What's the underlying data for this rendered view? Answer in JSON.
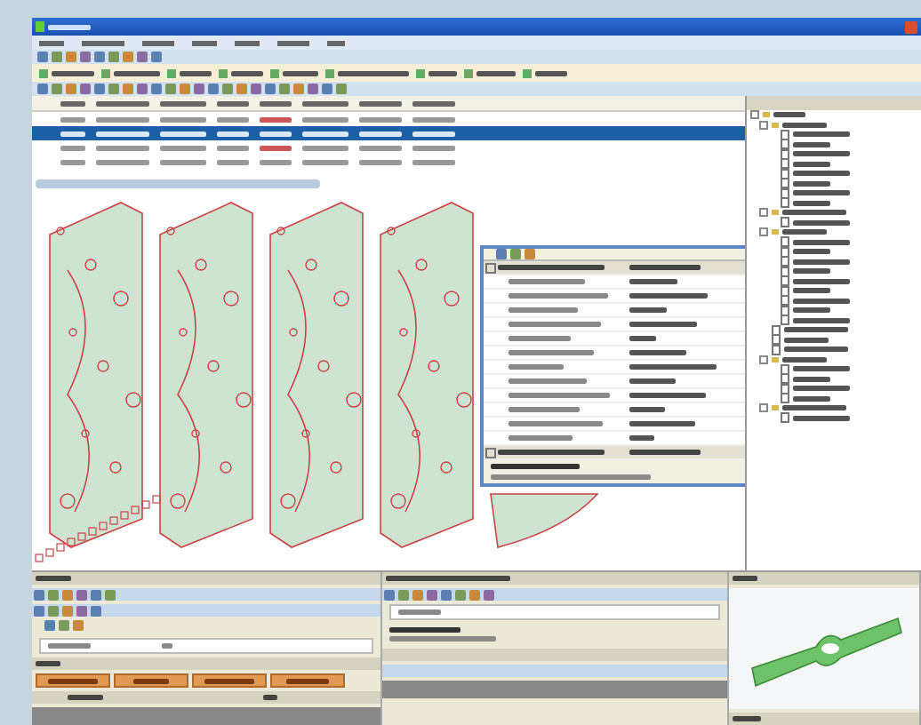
{
  "table": {
    "rows": [
      {
        "selected": false
      },
      {
        "selected": true
      },
      {
        "selected": false
      },
      {
        "selected": false
      }
    ]
  },
  "properties": {
    "rows": [
      {
        "kind": "group"
      },
      {
        "kind": "item"
      },
      {
        "kind": "item"
      },
      {
        "kind": "item"
      },
      {
        "kind": "item"
      },
      {
        "kind": "item"
      },
      {
        "kind": "item"
      },
      {
        "kind": "item"
      },
      {
        "kind": "item"
      },
      {
        "kind": "item"
      },
      {
        "kind": "item"
      },
      {
        "kind": "item"
      },
      {
        "kind": "item"
      },
      {
        "kind": "group"
      }
    ]
  },
  "tree": {
    "children": [
      {
        "kind": "folder",
        "expanded": true,
        "children": [
          {
            "kind": "folder",
            "expanded": true,
            "children": [
              {
                "kind": "leaf"
              },
              {
                "kind": "leaf"
              },
              {
                "kind": "leaf"
              },
              {
                "kind": "leaf"
              },
              {
                "kind": "leaf"
              },
              {
                "kind": "leaf"
              },
              {
                "kind": "leaf"
              },
              {
                "kind": "leaf"
              }
            ]
          },
          {
            "kind": "folder",
            "expanded": true,
            "children": [
              {
                "kind": "leaf"
              }
            ]
          },
          {
            "kind": "folder",
            "expanded": true,
            "children": [
              {
                "kind": "leaf"
              },
              {
                "kind": "leaf"
              },
              {
                "kind": "leaf"
              },
              {
                "kind": "leaf"
              },
              {
                "kind": "leaf"
              },
              {
                "kind": "leaf"
              },
              {
                "kind": "leaf"
              },
              {
                "kind": "leaf"
              },
              {
                "kind": "leaf"
              }
            ]
          },
          {
            "kind": "leaf"
          },
          {
            "kind": "leaf"
          },
          {
            "kind": "leaf"
          },
          {
            "kind": "folder",
            "expanded": true,
            "children": [
              {
                "kind": "leaf"
              },
              {
                "kind": "leaf"
              },
              {
                "kind": "leaf"
              },
              {
                "kind": "leaf"
              }
            ]
          },
          {
            "kind": "folder",
            "expanded": true,
            "children": [
              {
                "kind": "leaf"
              }
            ]
          }
        ]
      }
    ]
  }
}
